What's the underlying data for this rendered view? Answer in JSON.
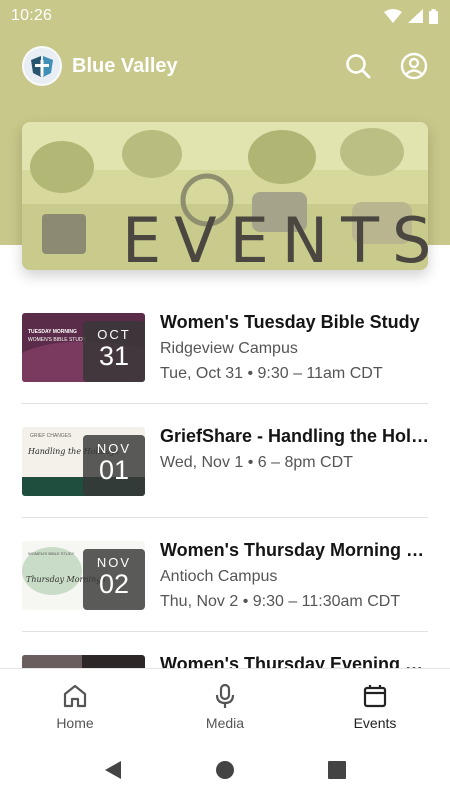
{
  "status_bar": {
    "time": "10:26"
  },
  "app_bar": {
    "title": "Blue Valley"
  },
  "banner": {
    "title": "EVENTS"
  },
  "events": [
    {
      "month": "OCT",
      "day": "31",
      "title": "Women's Tuesday Bible Study",
      "location": "Ridgeview Campus",
      "datetime": "Tue, Oct 31 • 9:30 – 11am CDT",
      "thumb_text_1": "TUESDAY MORNING",
      "thumb_text_2": "WOMEN'S BIBLE STUDY"
    },
    {
      "month": "NOV",
      "day": "01",
      "title": "GriefShare - Handling the Holidays",
      "location": "",
      "datetime": "Wed, Nov 1 • 6 – 8pm CDT",
      "thumb_text_1": "GRIEF CHANGES",
      "thumb_text_2": "Handling the Holidays"
    },
    {
      "month": "NOV",
      "day": "02",
      "title": "Women's Thursday Morning Bible Study",
      "location": "Antioch Campus",
      "datetime": "Thu, Nov 2 • 9:30 – 11:30am CDT",
      "thumb_text_1": "WOMEN'S BIBLE STUDY",
      "thumb_text_2": "Thursday Mornings"
    },
    {
      "month": "",
      "day": "",
      "title": "Women's Thursday Evening Bible Study",
      "location": "",
      "datetime": "",
      "thumb_text_1": "",
      "thumb_text_2": ""
    }
  ],
  "bottom_nav": {
    "items": [
      {
        "label": "Home",
        "icon": "home-icon"
      },
      {
        "label": "Media",
        "icon": "microphone-icon"
      },
      {
        "label": "Events",
        "icon": "calendar-icon",
        "active": true
      }
    ]
  },
  "colors": {
    "header": "#c8c88a",
    "badge": "#373737"
  }
}
